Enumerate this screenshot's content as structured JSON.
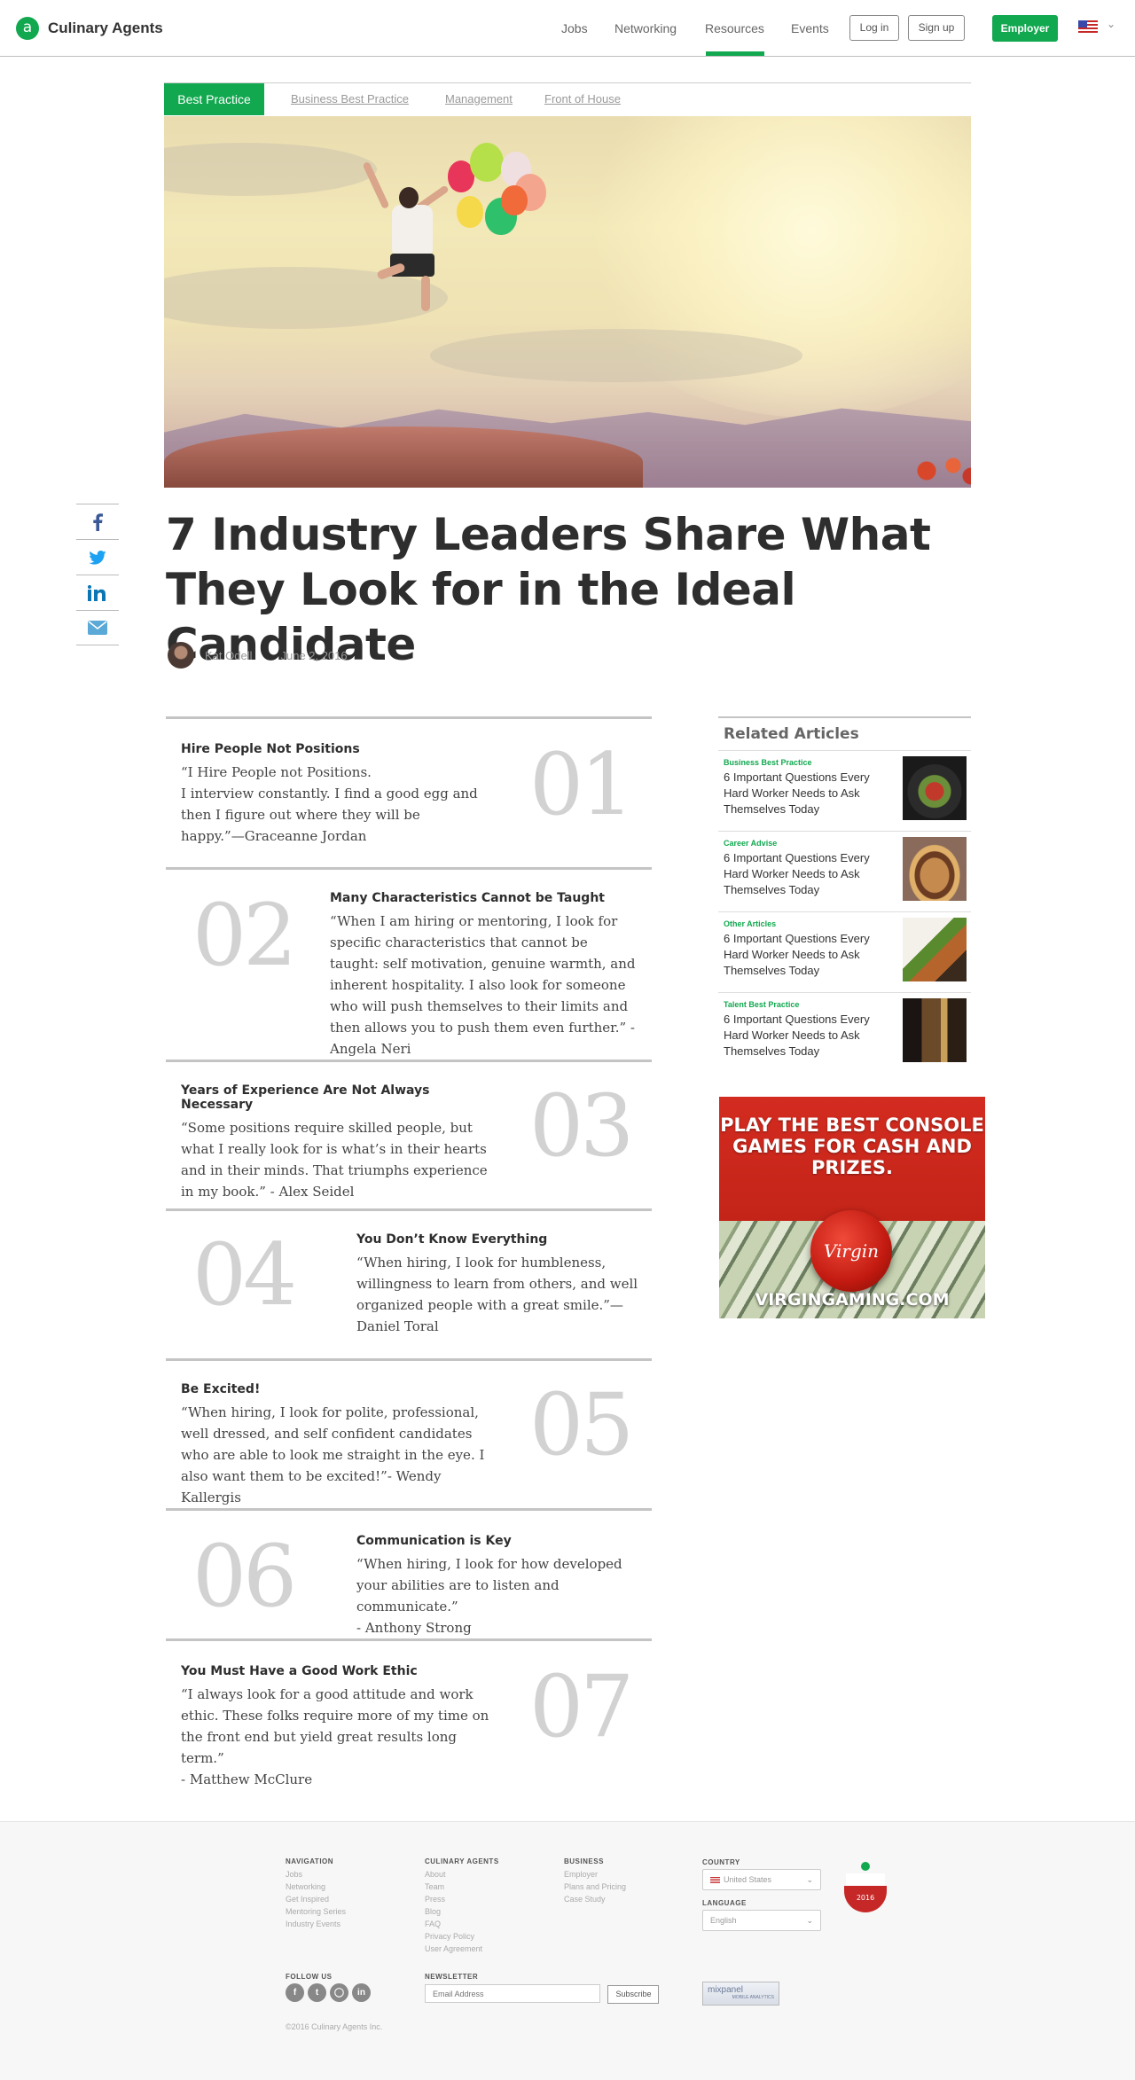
{
  "header": {
    "logo_mark": "a",
    "logo_text": "Culinary Agents",
    "nav": [
      "Jobs",
      "Networking",
      "Resources",
      "Events"
    ],
    "active_nav": "Resources",
    "login": "Log in",
    "signup": "Sign up",
    "employer": "Employer",
    "flag_icon": "us-flag-icon",
    "accent": "#11a84f"
  },
  "categories": {
    "active": "Best Practice",
    "links": [
      "Business Best Practice",
      "Management",
      "Front of House"
    ]
  },
  "share": [
    "facebook-icon",
    "twitter-icon",
    "linkedin-icon",
    "email-icon"
  ],
  "article": {
    "title": "7 Industry Leaders Share What They Look for in the Ideal Candidate",
    "author": "Kat Odell",
    "date": "June 2, 2016"
  },
  "quotes": [
    {
      "num": "01",
      "head": "Hire People Not Positions",
      "body": "“I Hire People not Positions.\nI interview constantly. I find a good egg and then I figure out where they will be happy.”—Graceanne Jordan"
    },
    {
      "num": "02",
      "head": "Many Characteristics Cannot be Taught",
      "body": "“When I am hiring or mentoring, I look for specific characteristics that cannot be taught: self motivation, genuine warmth, and inherent hospitality. I also look for someone who will push themselves to their limits and then allows you to push them even further.” - Angela Neri"
    },
    {
      "num": "03",
      "head": "Years of Experience Are Not Always Necessary",
      "body": "“Some positions require skilled people, but what I really look for is what’s in their hearts and in their minds. That triumphs experience in my book.” - Alex Seidel"
    },
    {
      "num": "04",
      "head": "You Don’t Know Everything",
      "body": "“When hiring, I look for humbleness, willingness to learn from others, and well organized people with a great smile.”—Daniel Toral"
    },
    {
      "num": "05",
      "head": "Be Excited!",
      "body": "“When hiring, I look for polite, professional, well dressed, and self confident candidates who are able to look me straight in the eye. I also want them to be excited!”- Wendy Kallergis"
    },
    {
      "num": "06",
      "head": "Communication is Key",
      "body": "“When hiring, I look for how developed your abilities are to listen and communicate.”\n- Anthony Strong"
    },
    {
      "num": "07",
      "head": "You Must Have a Good Work Ethic",
      "body": "“I always look for a good attitude and work ethic. These folks require more of my time on the front end but yield great results long term.”\n- Matthew McClure"
    }
  ],
  "related": {
    "title": "Related Articles",
    "items": [
      {
        "category": "Business Best Practice",
        "text": "6 Important Questions Every Hard Worker Needs to Ask Themselves Today"
      },
      {
        "category": "Career Advise",
        "text": "6 Important Questions Every Hard Worker Needs to Ask Themselves Today"
      },
      {
        "category": "Other Articles",
        "text": "6 Important Questions Every Hard Worker Needs to Ask Themselves Today"
      },
      {
        "category": "Talent Best Practice",
        "text": "6 Important Questions Every Hard Worker Needs to Ask Themselves Today"
      }
    ]
  },
  "ad": {
    "headline": "PLAY THE BEST CONSOLE GAMES FOR CASH AND PRIZES.",
    "logo": "Virgin",
    "url": "VIRGINGAMING.COM"
  },
  "footer": {
    "navigation": {
      "head": "NAVIGATION",
      "links": [
        "Jobs",
        "Networking",
        "Get Inspired",
        "Mentoring Series",
        "Industry Events"
      ]
    },
    "culinary": {
      "head": "CULINARY AGENTS",
      "links": [
        "About",
        "Team",
        "Press",
        "Blog",
        "FAQ",
        "Privacy Policy",
        "User Agreement"
      ]
    },
    "business": {
      "head": "BUSINESS",
      "links": [
        "Employer",
        "Plans and Pricing",
        "Case Study"
      ]
    },
    "country": {
      "head": "COUNTRY",
      "value": "United States"
    },
    "language": {
      "head": "LANGUAGE",
      "value": "English"
    },
    "follow": {
      "head": "FOLLOW US",
      "icons": [
        "facebook-icon",
        "twitter-icon",
        "instagram-icon",
        "linkedin-icon"
      ]
    },
    "newsletter": {
      "head": "NEWSLETTER",
      "placeholder": "Email Address",
      "button": "Subscribe"
    },
    "mixpanel": {
      "name": "mixpanel",
      "sub": "MOBILE ANALYTICS"
    },
    "badge": {
      "year": "2016"
    },
    "copyright": "©2016 Culinary Agents Inc."
  }
}
